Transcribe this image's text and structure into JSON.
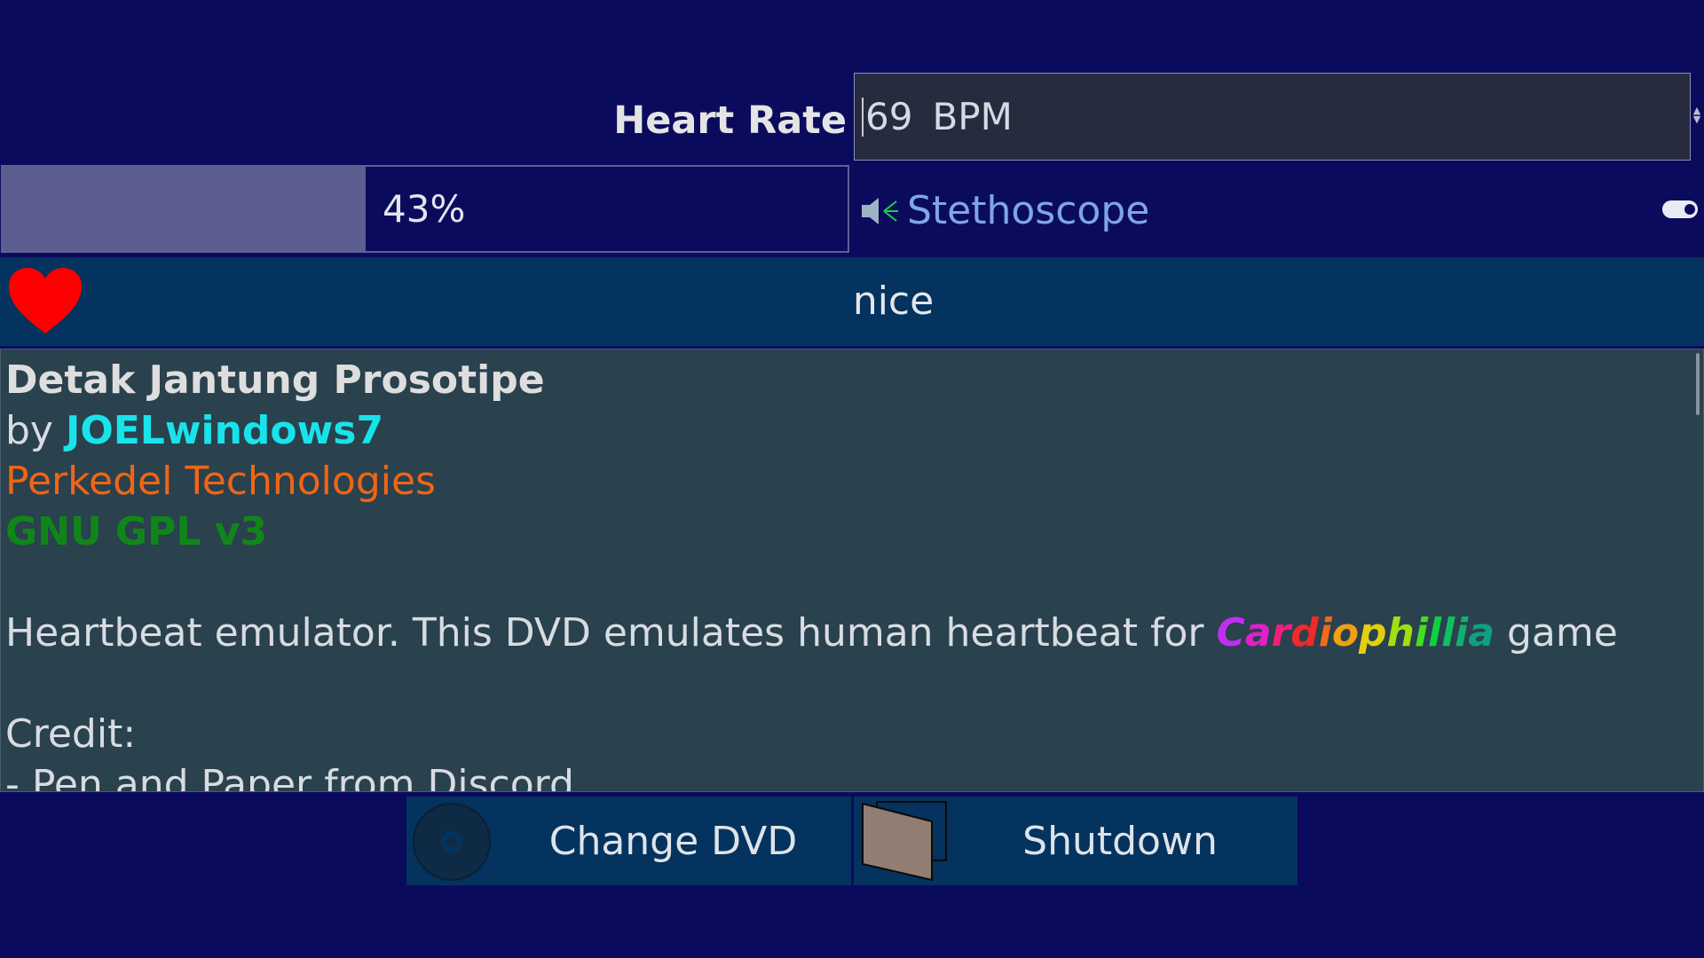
{
  "heart_rate": {
    "label": "Heart Rate",
    "value": "69",
    "unit": "BPM"
  },
  "progress": {
    "percent": 43,
    "text": "43%"
  },
  "stethoscope": {
    "label": "Stethoscope",
    "toggle_on": true
  },
  "status": {
    "text": "nice",
    "icon": "heart-icon"
  },
  "info": {
    "title": "Detak Jantung Prosotipe",
    "by_prefix": "by",
    "author": "JOELwindows7",
    "company": "Perkedel Technologies",
    "license": "GNU GPL v3",
    "description_prefix": "Heartbeat emulator. This DVD emulates human heartbeat for",
    "game_name": "Cardiophillia",
    "description_suffix": "game",
    "credit_label": "Credit:",
    "credit_item": "- Pen and Paper from Discord"
  },
  "buttons": {
    "change_dvd": "Change DVD",
    "shutdown": "Shutdown"
  },
  "colors": {
    "background": "#0b0b5e",
    "panel": "#2a414e",
    "bar": "#03335e",
    "author": "#19e3ea",
    "company": "#f06514",
    "license": "#10861a"
  }
}
